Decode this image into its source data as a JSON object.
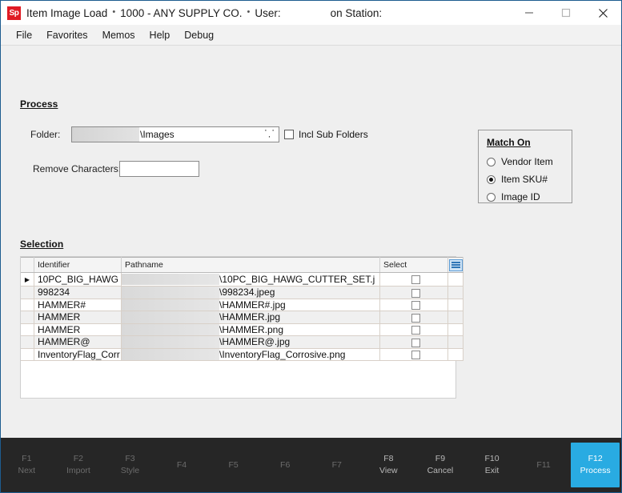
{
  "window": {
    "app_icon_text": "Sp",
    "title": "Item Image Load",
    "company": "1000 - ANY SUPPLY CO.",
    "user_label": "User:",
    "station_label": "on Station:",
    "separator": "•"
  },
  "menubar": {
    "items": [
      {
        "label": "File"
      },
      {
        "label": "Favorites"
      },
      {
        "label": "Memos"
      },
      {
        "label": "Help"
      },
      {
        "label": "Debug"
      }
    ]
  },
  "process": {
    "section_title": "Process",
    "folder_label": "Folder:",
    "folder_value": "\\Images",
    "folder_browse": "· · ·",
    "incl_sub_folders_label": "Incl Sub Folders",
    "incl_sub_folders_checked": false,
    "remove_characters_label": "Remove Characters:",
    "remove_characters_value": "",
    "remove_characters_placeholder": ""
  },
  "match_on": {
    "title": "Match On",
    "options": [
      {
        "label": "Vendor Item",
        "selected": false
      },
      {
        "label": "Item SKU#",
        "selected": true
      },
      {
        "label": "Image ID",
        "selected": false
      }
    ]
  },
  "selection": {
    "section_title": "Selection",
    "columns": [
      "Identifier",
      "Pathname",
      "Select"
    ],
    "rows": [
      {
        "marker": "▶",
        "identifier": "10PC_BIG_HAWG",
        "pathname": "\\10PC_BIG_HAWG_CUTTER_SET.j",
        "selected": false
      },
      {
        "marker": "",
        "identifier": "998234",
        "pathname": "\\998234.jpeg",
        "selected": false
      },
      {
        "marker": "",
        "identifier": "HAMMER#",
        "pathname": "\\HAMMER#.jpg",
        "selected": false
      },
      {
        "marker": "",
        "identifier": "HAMMER",
        "pathname": "\\HAMMER.jpg",
        "selected": false
      },
      {
        "marker": "",
        "identifier": "HAMMER",
        "pathname": "\\HAMMER.png",
        "selected": false
      },
      {
        "marker": "",
        "identifier": "HAMMER@",
        "pathname": "\\HAMMER@.jpg",
        "selected": false
      },
      {
        "marker": "",
        "identifier": "InventoryFlag_Corr",
        "pathname": "\\InventoryFlag_Corrosive.png",
        "selected": false
      }
    ]
  },
  "function_bar": {
    "accent_color": "#29abe2",
    "background_color": "#262626",
    "keys": [
      {
        "code": "F1",
        "label": "Next",
        "active": false
      },
      {
        "code": "F2",
        "label": "Import",
        "active": false
      },
      {
        "code": "F3",
        "label": "Style",
        "active": false
      },
      {
        "code": "F4",
        "label": "",
        "active": false
      },
      {
        "code": "F5",
        "label": "",
        "active": false
      },
      {
        "code": "F6",
        "label": "",
        "active": false
      },
      {
        "code": "F7",
        "label": "",
        "active": false
      },
      {
        "code": "F8",
        "label": "View",
        "active": false
      },
      {
        "code": "F9",
        "label": "Cancel",
        "active": false
      },
      {
        "code": "F10",
        "label": "Exit",
        "active": false
      },
      {
        "code": "F11",
        "label": "",
        "active": false
      },
      {
        "code": "F12",
        "label": "Process",
        "active": true
      }
    ]
  }
}
